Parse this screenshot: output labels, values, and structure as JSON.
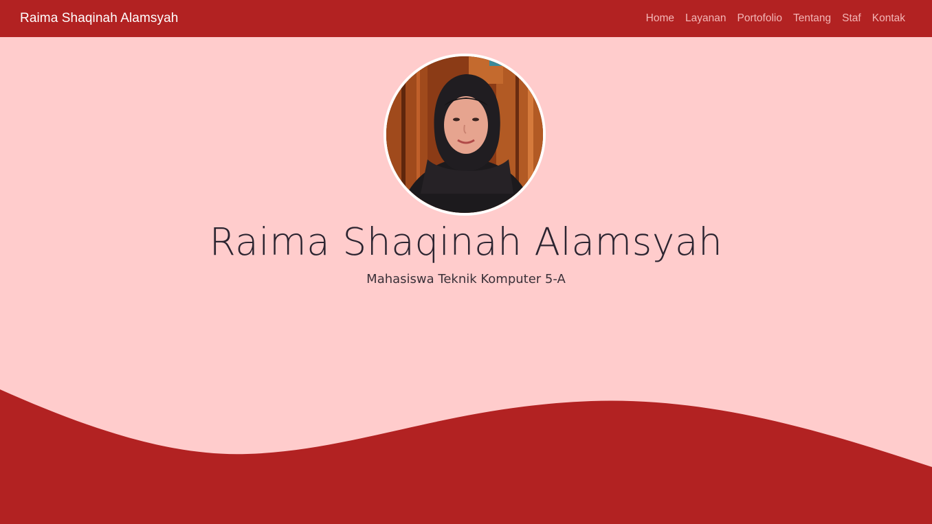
{
  "nav": {
    "brand": "Raima Shaqinah Alamsyah",
    "links": [
      {
        "label": "Home"
      },
      {
        "label": "Layanan"
      },
      {
        "label": "Portofolio"
      },
      {
        "label": "Tentang"
      },
      {
        "label": "Staf"
      },
      {
        "label": "Kontak"
      }
    ]
  },
  "hero": {
    "name": "Raima Shaqinah Alamsyah",
    "subtitle": "Mahasiswa Teknik Komputer 5-A",
    "avatar_icon": "profile-photo"
  },
  "colors": {
    "primary": "#b22222",
    "background": "#ffcccc",
    "nav_link": "#f3b6b6",
    "brand_text": "#ffffff",
    "heading_text": "#2b2430"
  }
}
